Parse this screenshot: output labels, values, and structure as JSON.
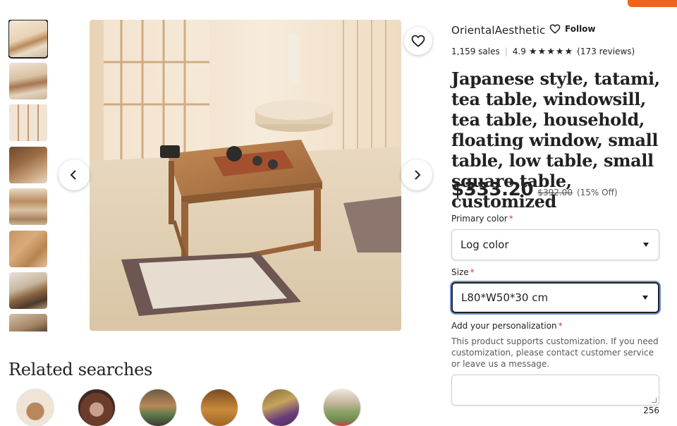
{
  "shop": {
    "name": "OrientalAesthetic",
    "follow_label": "Follow",
    "sales": "1,159 sales",
    "rating": "4.9",
    "stars": 5,
    "reviews": "(173 reviews)"
  },
  "listing": {
    "title": "Japanese style, tatami, tea table, windowsill, tea table, household, floating window, small table, low table, small square table, customized",
    "price": "$333.20",
    "original_price": "$392.00",
    "discount": "(15% Off)"
  },
  "options": {
    "primary_color": {
      "label": "Primary color",
      "required_mark": "*",
      "selected": "Log color"
    },
    "size": {
      "label": "Size",
      "required_mark": "*",
      "selected": "L80*W50*30 cm"
    },
    "personalization": {
      "label": "Add your personalization",
      "required_mark": "*",
      "help": "This product supports customization. If you need customization, please contact customer service or leave us a message.",
      "remaining": "256"
    }
  },
  "gallery": {
    "thumbnail_count": 8,
    "selected_index": 0
  },
  "related": {
    "title": "Related searches",
    "item_count": 6
  },
  "icons": {
    "favorite": "heart-icon",
    "follow": "heart-outline-icon",
    "prev": "chevron-left-icon",
    "next": "chevron-right-icon",
    "rating": "star-icon"
  },
  "colors": {
    "accent": "#f1641e",
    "required": "#d63b3b",
    "focus_ring": "#6b8dd6",
    "text": "#222222"
  }
}
